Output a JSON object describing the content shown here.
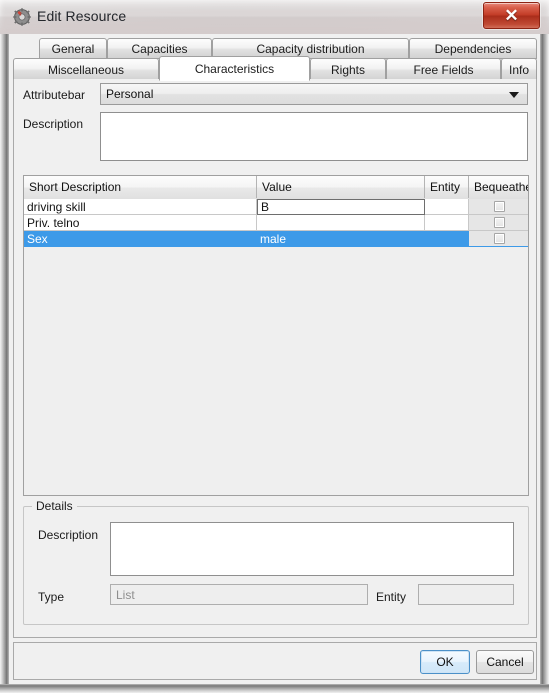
{
  "window": {
    "title": "Edit Resource",
    "icon": "gear-icon",
    "close_label": "✕"
  },
  "tabs_row1": [
    {
      "label": "General",
      "active": false
    },
    {
      "label": "Capacities",
      "active": false
    },
    {
      "label": "Capacity distribution",
      "active": false
    },
    {
      "label": "Dependencies",
      "active": false
    }
  ],
  "tabs_row2": [
    {
      "label": "Miscellaneous",
      "active": false
    },
    {
      "label": "Characteristics",
      "active": true
    },
    {
      "label": "Rights",
      "active": false
    },
    {
      "label": "Free Fields",
      "active": false
    },
    {
      "label": "Info",
      "active": false
    }
  ],
  "form": {
    "attributebar_label": "Attributebar",
    "attributebar_value": "Personal",
    "description_label": "Description",
    "description_value": ""
  },
  "table": {
    "columns": [
      "Short Description",
      "Value",
      "Entity",
      "Bequeathed"
    ],
    "rows": [
      {
        "short_description": "driving skill",
        "value": "B",
        "entity": "",
        "bequeathed": false,
        "selected": false,
        "editing": true
      },
      {
        "short_description": "Priv. telno",
        "value": "",
        "entity": "",
        "bequeathed": false,
        "selected": false,
        "editing": false
      },
      {
        "short_description": "Sex",
        "value": "male",
        "entity": "",
        "bequeathed": false,
        "selected": true,
        "editing": false
      }
    ]
  },
  "details": {
    "title": "Details",
    "description_label": "Description",
    "description_value": "",
    "type_label": "Type",
    "type_value": "List",
    "entity_label": "Entity",
    "entity_value": ""
  },
  "buttons": {
    "ok": "OK",
    "cancel": "Cancel"
  },
  "colors": {
    "selection_blue": "#3d9ae8",
    "close_red": "#c23c27",
    "panel_gray": "#f0f0f0",
    "default_button_blue": "#4b90c8"
  }
}
